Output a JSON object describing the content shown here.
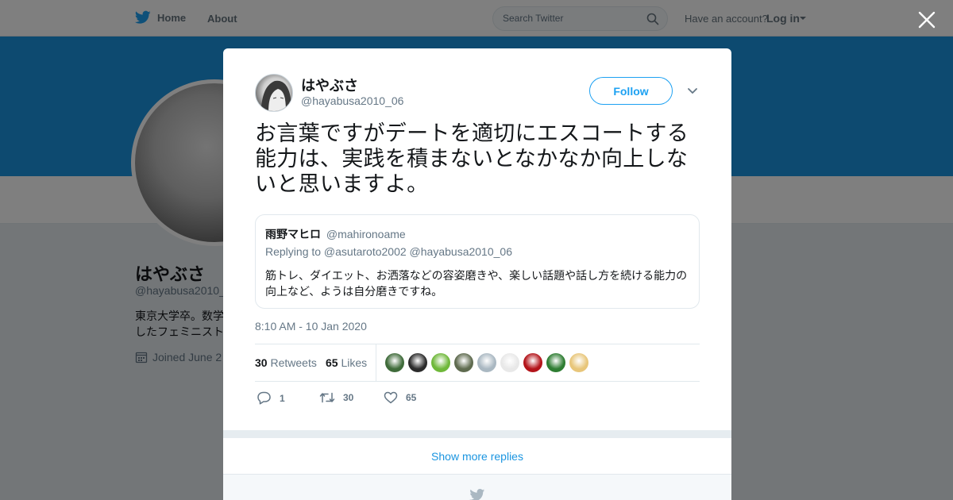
{
  "topnav": {
    "home_label": "Home",
    "about_label": "About",
    "search_placeholder": "Search Twitter",
    "account_prompt": "Have an account?",
    "login_label": "Log in"
  },
  "profile": {
    "name": "はやぶさ",
    "handle": "@hayabusa2010_",
    "bio": "東京大学卒。数学したフェミニスト",
    "joined": "Joined June 2"
  },
  "tweet": {
    "author_name": "はやぶさ",
    "author_handle": "@hayabusa2010_06",
    "follow_label": "Follow",
    "text": "お言葉ですがデートを適切にエスコートする能力は、実践を積まないとなかなか向上しないと思いますよ。",
    "quote": {
      "name": "雨野マヒロ",
      "handle": "@mahironoame",
      "reply_line": "Replying to @asutaroto2002 @hayabusa2010_06",
      "text": "筋トレ、ダイエット、お洒落などの容姿磨きや、楽しい話題や話し方を続ける能力の向上など、ようは自分磨きですね。"
    },
    "timestamp": "8:10 AM - 10 Jan 2020",
    "stats": {
      "retweets_count": "30",
      "retweets_label": "Retweets",
      "likes_count": "65",
      "likes_label": "Likes"
    },
    "liker_colors": [
      "#3f6b3a",
      "#2b2b2b",
      "#6fb83a",
      "#5f6b4f",
      "#aab8c2",
      "#e8e8e8",
      "#b3141a",
      "#2e7d32",
      "#e8c67a"
    ],
    "actions": {
      "reply_count": "1",
      "retweet_count": "30",
      "like_count": "65"
    }
  },
  "show_more_label": "Show more replies",
  "colors": {
    "accent": "#1da1f2",
    "link": "#1b95e0",
    "banner": "#1b95e0",
    "muted": "#657786"
  }
}
